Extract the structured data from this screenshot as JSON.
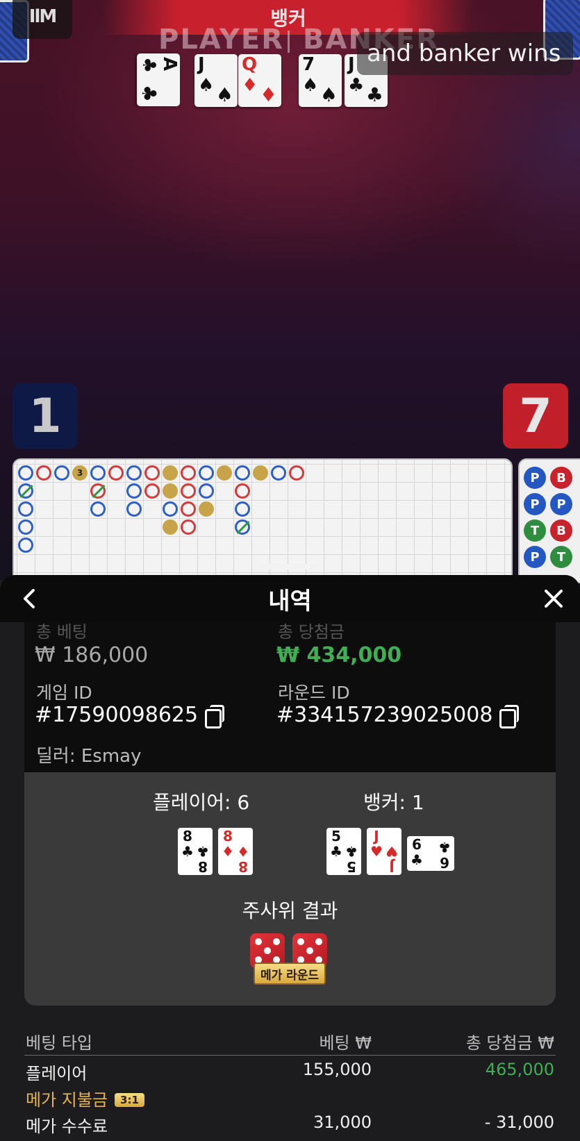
{
  "video": {
    "banner_title": "뱅커",
    "felt_player": "PLAYER",
    "felt_banker": "BANKER",
    "subtitle": "and banker wins",
    "player_score": "1",
    "banker_score": "7",
    "table_cards": [
      {
        "rank": "A",
        "suit": "♣",
        "red": false
      },
      {
        "rank": "J",
        "suit": "♠",
        "red": false
      },
      {
        "rank": "Q",
        "suit": "♦",
        "red": true
      },
      {
        "rank": "7",
        "suit": "♠",
        "red": false
      },
      {
        "rank": "J",
        "suit": "♣",
        "red": false
      }
    ],
    "roadmap_marker": "3",
    "bead_road": [
      "P",
      "B",
      "P",
      "P",
      "T",
      "B",
      "P",
      "T"
    ]
  },
  "panel": {
    "title": "내역",
    "total_bet_label": "총 베팅",
    "total_bet_value": "₩ 186,000",
    "total_win_label": "총 당첨금",
    "total_win_value": "₩ 434,000",
    "game_id_label": "게임 ID",
    "game_id_value": "#17590098625",
    "round_id_label": "라운드 ID",
    "round_id_value": "#334157239025008",
    "dealer": "딜러: Esmay",
    "player_label": "플레이어: 6",
    "banker_label": "뱅커: 1",
    "player_cards": [
      {
        "rank": "8",
        "suit": "♣",
        "red": false
      },
      {
        "rank": "8",
        "suit": "♦",
        "red": true
      }
    ],
    "banker_cards": [
      {
        "rank": "5",
        "suit": "♣",
        "red": false
      },
      {
        "rank": "J",
        "suit": "♥",
        "red": true
      },
      {
        "rank": "6",
        "suit": "♣",
        "red": false
      }
    ],
    "dice_title": "주사위 결과",
    "dice_values": [
      5,
      5
    ],
    "mega_round_badge": "메가 라운드",
    "bets": {
      "headers": [
        "베팅 타입",
        "베팅 ₩",
        "총 당첨금 ₩"
      ],
      "rows": [
        {
          "type": "플레이어",
          "bet": "155,000",
          "win": "465,000"
        },
        {
          "type": "메가 지불금",
          "bet": "",
          "win": "",
          "badge": "3:1"
        },
        {
          "type": "메가 수수료",
          "bet": "31,000",
          "win": "- 31,000"
        }
      ]
    }
  },
  "colors": {
    "win_green": "#3fae54",
    "banker_red": "#c1202a",
    "player_navy": "#0f1945",
    "mega_gold": "#e7b54e"
  },
  "icons": {
    "back": "chevron-left-icon",
    "close": "close-icon",
    "copy": "copy-icon",
    "logo": "game-logo-icon"
  }
}
